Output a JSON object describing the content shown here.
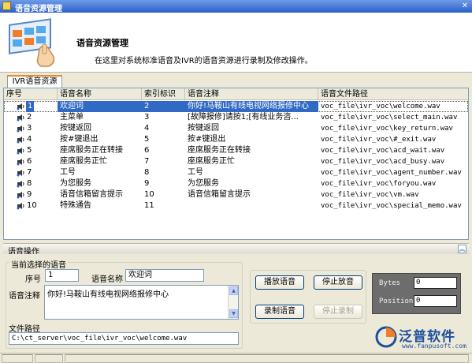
{
  "window": {
    "title": "语音资源管理"
  },
  "header": {
    "title": "语音资源管理",
    "description": "在这里对系统标准语音及IVR的语音资源进行录制及修改操作。"
  },
  "tab": {
    "label": "IVR语音资源"
  },
  "table": {
    "columns": [
      "序号",
      "语音名称",
      "索引标识",
      "语音注释",
      "语音文件路径"
    ],
    "rows": [
      {
        "seq": "1",
        "name": "欢迎词",
        "index": "2",
        "note": "你好!马鞍山有线电视网络报修中心",
        "path": "voc_file\\ivr_voc\\welcome.wav",
        "selected": true
      },
      {
        "seq": "2",
        "name": "主菜单",
        "index": "3",
        "note": "[故障报修]请按1;[有线业务咨...",
        "path": "voc_file\\ivr_voc\\select_main.wav"
      },
      {
        "seq": "3",
        "name": "按键返回",
        "index": "4",
        "note": "按键返回",
        "path": "voc_file\\ivr_voc\\key_return.wav"
      },
      {
        "seq": "4",
        "name": "按#键退出",
        "index": "5",
        "note": "按#键退出",
        "path": "voc_file\\ivr_voc\\#_exit.wav"
      },
      {
        "seq": "5",
        "name": "座席服务正在转接",
        "index": "6",
        "note": "座席服务正在转接",
        "path": "voc_file\\ivr_voc\\acd_wait.wav"
      },
      {
        "seq": "6",
        "name": "座席服务正忙",
        "index": "7",
        "note": "座席服务正忙",
        "path": "voc_file\\ivr_voc\\acd_busy.wav"
      },
      {
        "seq": "7",
        "name": "工号",
        "index": "8",
        "note": "工号",
        "path": "voc_file\\ivr_voc\\agent_number.wav"
      },
      {
        "seq": "8",
        "name": "为您服务",
        "index": "9",
        "note": "为您服务",
        "path": "voc_file\\ivr_voc\\foryou.wav"
      },
      {
        "seq": "9",
        "name": "语音信箱留言提示",
        "index": "10",
        "note": "语音信箱留言提示",
        "path": "voc_file\\ivr_voc\\vm.wav"
      },
      {
        "seq": "10",
        "name": "特殊通告",
        "index": "11",
        "note": "",
        "path": "voc_file\\ivr_voc\\special_memo.wav"
      }
    ]
  },
  "ops": {
    "bar_label": "语音操作",
    "group_title": "当前选择的语音",
    "seq_label": "序号",
    "seq_value": "1",
    "name_label": "语音名称",
    "name_value": "欢迎词",
    "note_label": "语音注释",
    "note_value": "你好!马鞍山有线电视网络报修中心",
    "path_label": "文件路径",
    "path_value": "C:\\ct_server\\voc_file\\ivr_voc\\welcome.wav",
    "play_label": "播放语音",
    "stop_play_label": "停止放音",
    "record_label": "录制语音",
    "stop_record_label": "停止录制"
  },
  "meter": {
    "bytes_label": "Bytes",
    "bytes_value": "0",
    "position_label": "Position",
    "position_value": "0"
  },
  "brand": {
    "name": "泛普软件",
    "url": "www.fanpusoft.com"
  }
}
